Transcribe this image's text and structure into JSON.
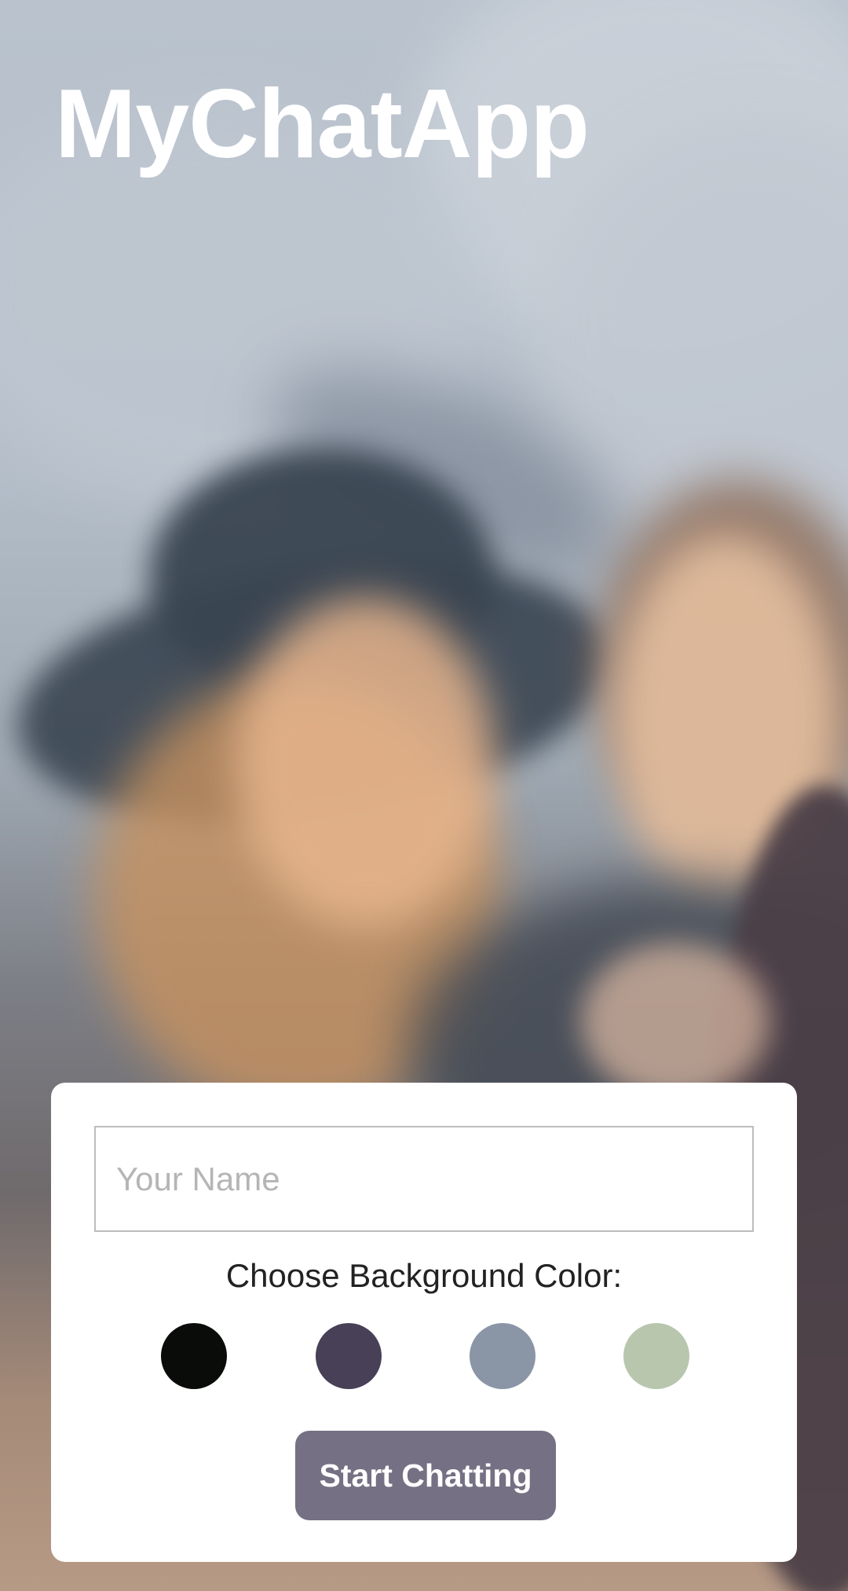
{
  "app": {
    "title": "MyChatApp"
  },
  "start_form": {
    "name_input": {
      "placeholder": "Your Name",
      "value": ""
    },
    "color_label": "Choose Background Color:",
    "color_options": [
      {
        "name": "black",
        "hex": "#090C08"
      },
      {
        "name": "purple",
        "hex": "#474056"
      },
      {
        "name": "gray-blue",
        "hex": "#8A95A5"
      },
      {
        "name": "green",
        "hex": "#B9C6AE"
      }
    ],
    "start_button_label": "Start Chatting",
    "colors": {
      "button_bg": "#757083",
      "button_text": "#FFFFFF",
      "card_bg": "#FFFFFF"
    }
  }
}
